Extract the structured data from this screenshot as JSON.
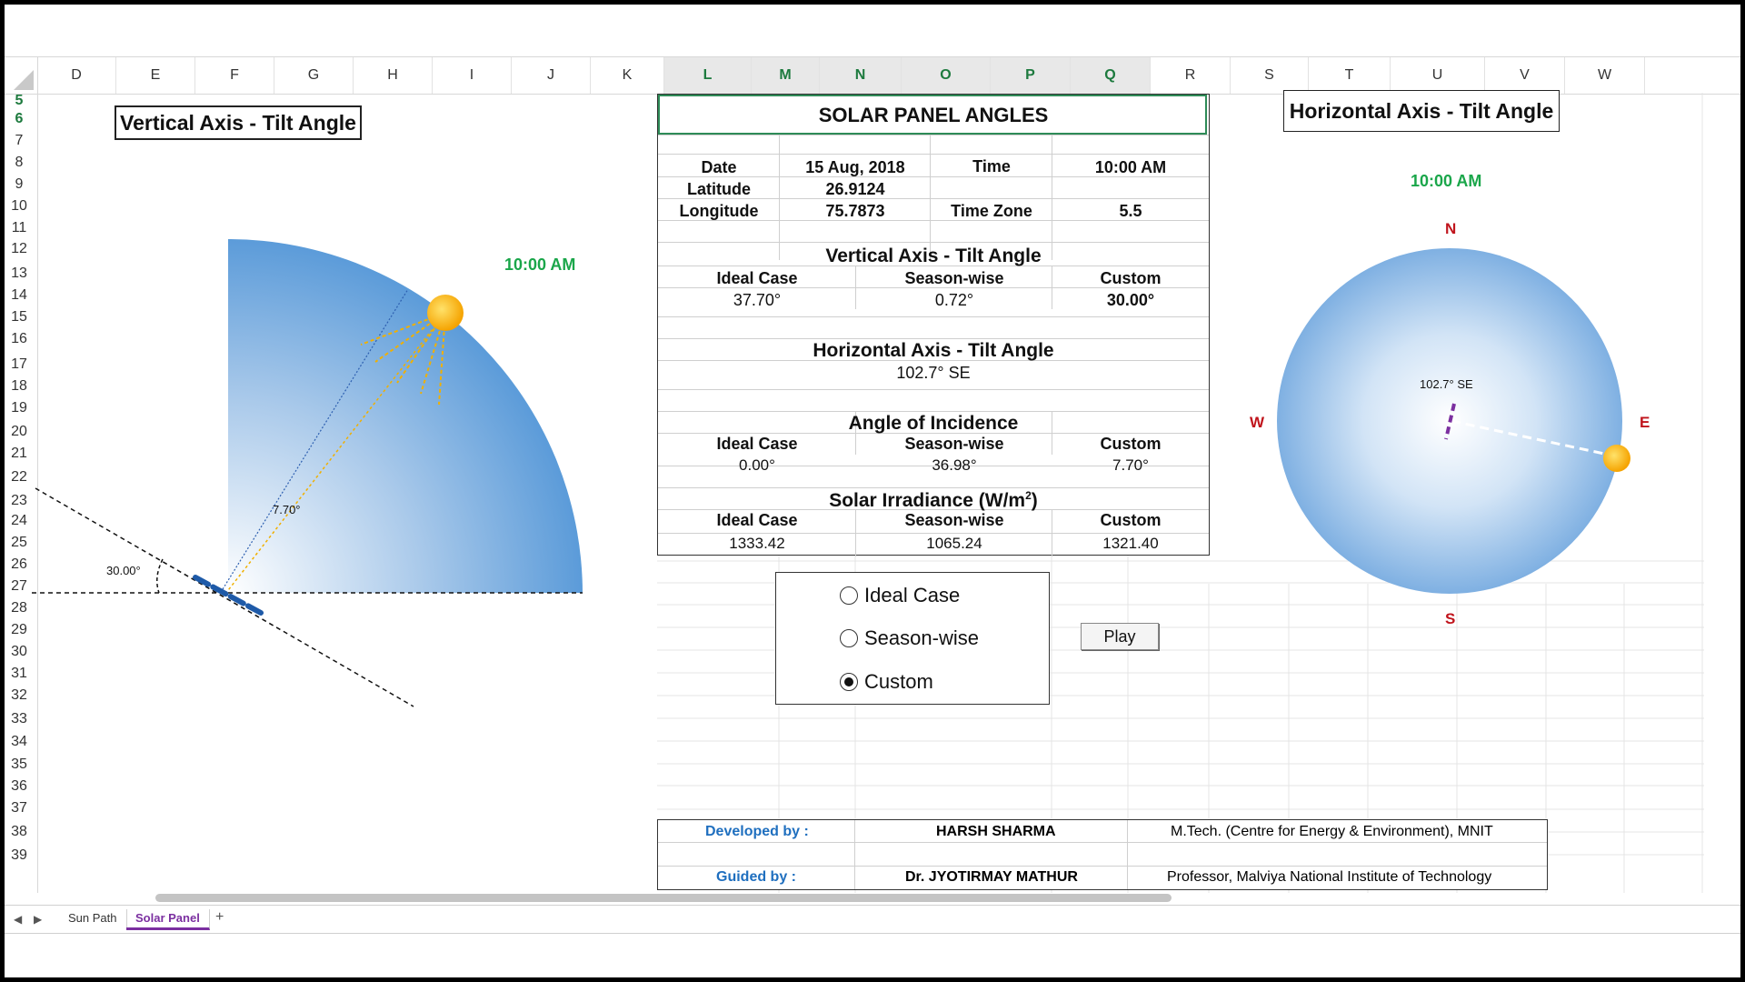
{
  "columns": [
    "D",
    "E",
    "F",
    "G",
    "H",
    "I",
    "J",
    "K",
    "L",
    "M",
    "N",
    "O",
    "P",
    "Q",
    "R",
    "S",
    "T",
    "U",
    "V",
    "W"
  ],
  "selected_columns": [
    "L",
    "M",
    "N",
    "O",
    "P",
    "Q"
  ],
  "rows": [
    "5",
    "6",
    "7",
    "8",
    "9",
    "10",
    "11",
    "12",
    "13",
    "14",
    "15",
    "16",
    "17",
    "18",
    "19",
    "20",
    "21",
    "22",
    "23",
    "24",
    "25",
    "26",
    "27",
    "28",
    "29",
    "30",
    "31",
    "32",
    "33",
    "34",
    "35",
    "36",
    "37",
    "38",
    "39"
  ],
  "selected_rows": [
    "5",
    "6"
  ],
  "left_panel": {
    "title": "Vertical Axis - Tilt Angle",
    "time": "10:00 AM",
    "tilt_label": "30.00°",
    "incidence_label": "7.70°"
  },
  "table": {
    "title": "SOLAR PANEL ANGLES",
    "date_label": "Date",
    "date_value": "15 Aug, 2018",
    "time_label": "Time",
    "time_value": "10:00 AM",
    "latitude_label": "Latitude",
    "latitude_value": "26.9124",
    "longitude_label": "Longitude",
    "longitude_value": "75.7873",
    "timezone_label": "Time Zone",
    "timezone_value": "5.5",
    "vertical_title": "Vertical Axis - Tilt Angle",
    "col_ideal": "Ideal Case",
    "col_season": "Season-wise",
    "col_custom": "Custom",
    "vertical_values": [
      "37.70°",
      "0.72°",
      "30.00°"
    ],
    "horizontal_title": "Horizontal Axis - Tilt Angle",
    "horizontal_value": "102.7° SE",
    "incidence_title": "Angle of Incidence",
    "incidence_values": [
      "0.00°",
      "36.98°",
      "7.70°"
    ],
    "irradiance_title": "Solar Irradiance (W/m",
    "irradiance_sup": "2",
    "irradiance_close": ")",
    "irradiance_values": [
      "1333.42",
      "1065.24",
      "1321.40"
    ]
  },
  "options": {
    "items": [
      "Ideal Case",
      "Season-wise",
      "Custom"
    ],
    "selected": "Custom"
  },
  "play_label": "Play",
  "right_panel": {
    "title": "Horizontal Axis - Tilt Angle",
    "time": "10:00 AM",
    "north": "N",
    "south": "S",
    "east": "E",
    "west": "W",
    "azimuth_label": "102.7° SE"
  },
  "credits": {
    "developed_label": "Developed by :",
    "developer": "HARSH SHARMA",
    "developer_info": "M.Tech. (Centre for Energy & Environment), MNIT",
    "guided_label": "Guided by :",
    "guide": "Dr. JYOTIRMAY  MATHUR",
    "guide_info": "Professor, Malviya National Institute of Technology"
  },
  "sheet_tabs": [
    "Sun Path",
    "Solar Panel"
  ],
  "active_tab": "Solar Panel",
  "add_tab": "+",
  "colors": {
    "accent_green": "#1aa64a",
    "label_blue": "#1f6fbf",
    "compass_red": "#c0141c",
    "sun": "#ffc21a",
    "tab_active": "#7b2fa0"
  }
}
